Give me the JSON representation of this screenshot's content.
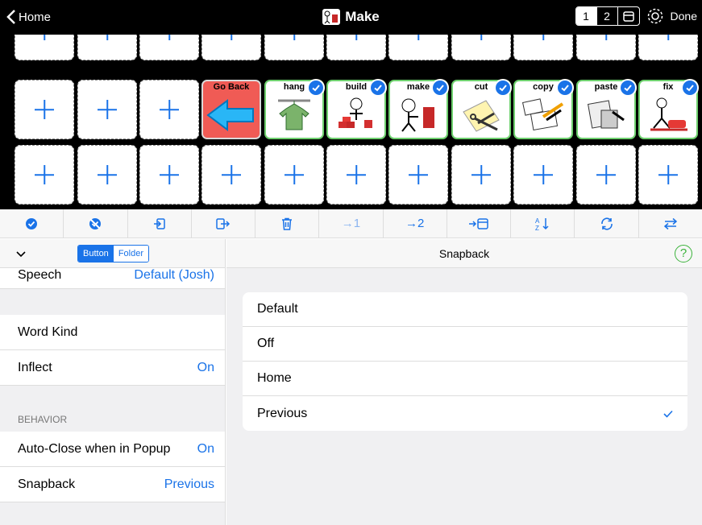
{
  "nav": {
    "back_label": "Home",
    "title": "Make",
    "pages": [
      "1",
      "2"
    ],
    "done_label": "Done"
  },
  "grid": {
    "words": [
      {
        "label": "Go Back",
        "selected": false
      },
      {
        "label": "hang",
        "selected": true
      },
      {
        "label": "build",
        "selected": true
      },
      {
        "label": "make",
        "selected": true
      },
      {
        "label": "cut",
        "selected": true
      },
      {
        "label": "copy",
        "selected": true
      },
      {
        "label": "paste",
        "selected": true
      },
      {
        "label": "fix",
        "selected": true
      }
    ]
  },
  "toolbar": {
    "icons": [
      "check-circle-icon",
      "deselect-icon",
      "import-icon",
      "export-icon",
      "trash-icon",
      "move-to-page-1-icon",
      "move-to-page-2-icon",
      "move-to-folder-icon",
      "sort-icon",
      "refresh-icon",
      "swap-icon"
    ],
    "move1": "→1",
    "move2": "→2"
  },
  "left": {
    "type_button": "Button",
    "type_folder": "Folder",
    "speech_label": "Speech",
    "speech_value": "Default (Josh)",
    "wordkind_label": "Word Kind",
    "inflect_label": "Inflect",
    "inflect_value": "On",
    "behavior_header": "BEHAVIOR",
    "autoclose_label": "Auto-Close when in Popup",
    "autoclose_value": "On",
    "snapback_label": "Snapback",
    "snapback_value": "Previous"
  },
  "right": {
    "title": "Snapback",
    "options": [
      "Default",
      "Off",
      "Home",
      "Previous"
    ],
    "selected": "Previous"
  },
  "colors": {
    "accent": "#1a73e8",
    "selected_border": "#6ed06e",
    "goback_bg": "#f05b55"
  }
}
